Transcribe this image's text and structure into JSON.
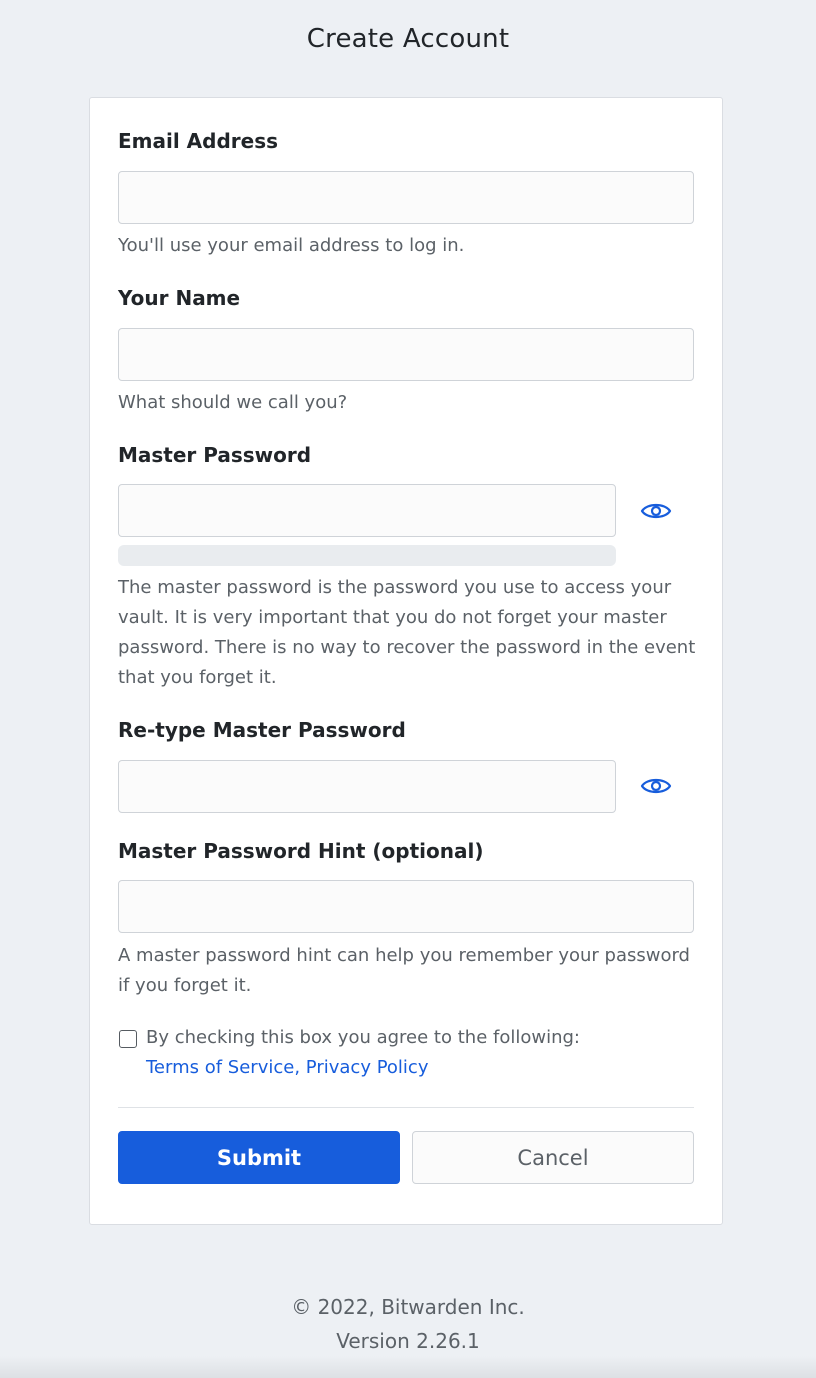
{
  "page": {
    "title": "Create Account"
  },
  "form": {
    "email": {
      "label": "Email Address",
      "value": "",
      "help": "You'll use your email address to log in."
    },
    "name": {
      "label": "Your Name",
      "value": "",
      "help": "What should we call you?"
    },
    "master_password": {
      "label": "Master Password",
      "value": "",
      "strength": 0,
      "help": "The master password is the password you use to access your vault. It is very important that you do not forget your master password. There is no way to recover the password in the event that you forget it."
    },
    "retype_password": {
      "label": "Re-type Master Password",
      "value": ""
    },
    "hint": {
      "label": "Master Password Hint (optional)",
      "value": "",
      "help": "A master password hint can help you remember your password if you forget it."
    },
    "terms": {
      "checked": false,
      "text": "By checking this box you agree to the following:",
      "terms_link": "Terms of Service",
      "separator": ",",
      "privacy_link": "Privacy Policy"
    },
    "buttons": {
      "submit": "Submit",
      "cancel": "Cancel"
    }
  },
  "footer": {
    "copyright": "© 2022, Bitwarden Inc.",
    "version": "Version 2.26.1"
  },
  "icons": {
    "toggle_visibility": "eye-icon"
  },
  "colors": {
    "primary": "#175ddc",
    "background": "#edf0f4",
    "muted_text": "#5b6167"
  }
}
